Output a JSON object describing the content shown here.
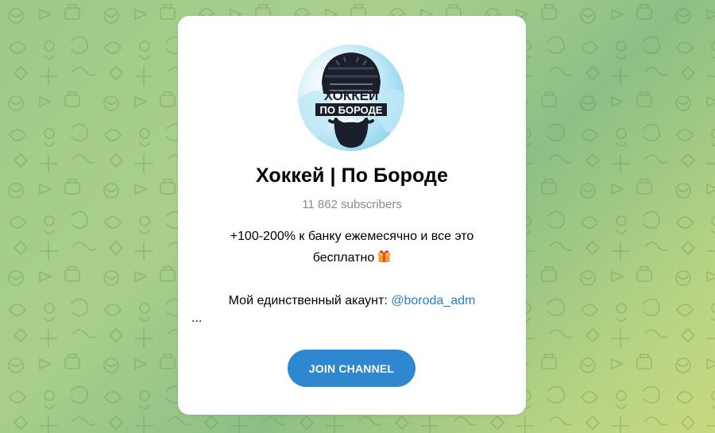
{
  "channel": {
    "title": "Хоккей | По Бороде",
    "subscribers": "11 862 subscribers",
    "avatar_text_line1": "ХОККЕЙ",
    "avatar_text_line2": "ПО БОРОДЕ",
    "description_line1": "+100-200% к банку ежемесячно и все это",
    "description_line2": "бесплатно",
    "description_gift_icon": "gift-emoji-icon",
    "description_line3_prefix": "Мой единственный акаунт: ",
    "description_mention": "@boroda_adm",
    "ellipsis": "..."
  },
  "actions": {
    "join_label": "JOIN CHANNEL"
  },
  "colors": {
    "accent": "#2f87d0",
    "link": "#2481cc",
    "muted": "#8a8a8a",
    "background_green": "#a9cf8c"
  }
}
